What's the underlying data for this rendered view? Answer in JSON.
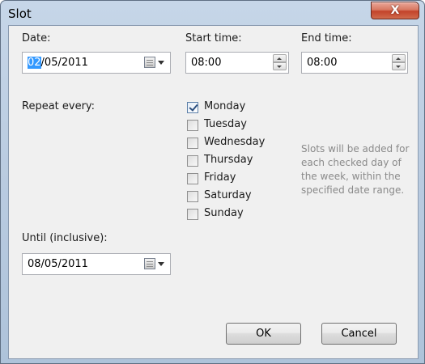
{
  "window": {
    "title": "Slot",
    "close_glyph": "X"
  },
  "labels": {
    "date": "Date:",
    "start_time": "Start time:",
    "end_time": "End time:",
    "repeat_every": "Repeat every:",
    "until": "Until (inclusive):"
  },
  "fields": {
    "date": {
      "selected_part": "02",
      "rest": "/05/2011"
    },
    "start_time": "08:00",
    "end_time": "08:00",
    "until": "08/05/2011"
  },
  "days": [
    {
      "label": "Monday",
      "checked": true
    },
    {
      "label": "Tuesday",
      "checked": false
    },
    {
      "label": "Wednesday",
      "checked": false
    },
    {
      "label": "Thursday",
      "checked": false
    },
    {
      "label": "Friday",
      "checked": false
    },
    {
      "label": "Saturday",
      "checked": false
    },
    {
      "label": "Sunday",
      "checked": false
    }
  ],
  "hint": "Slots will be added for each checked day of the week, within the specified date range.",
  "buttons": {
    "ok": "OK",
    "cancel": "Cancel"
  },
  "icons": {
    "calendar": "calendar-icon",
    "dropdown": "chevron-down-icon",
    "spin_up": "spin-up-icon",
    "spin_down": "spin-down-icon",
    "close": "close-icon"
  },
  "colors": {
    "selection": "#3399ff",
    "hint_text": "#8a8a8a",
    "close_button": "#c3432a"
  }
}
